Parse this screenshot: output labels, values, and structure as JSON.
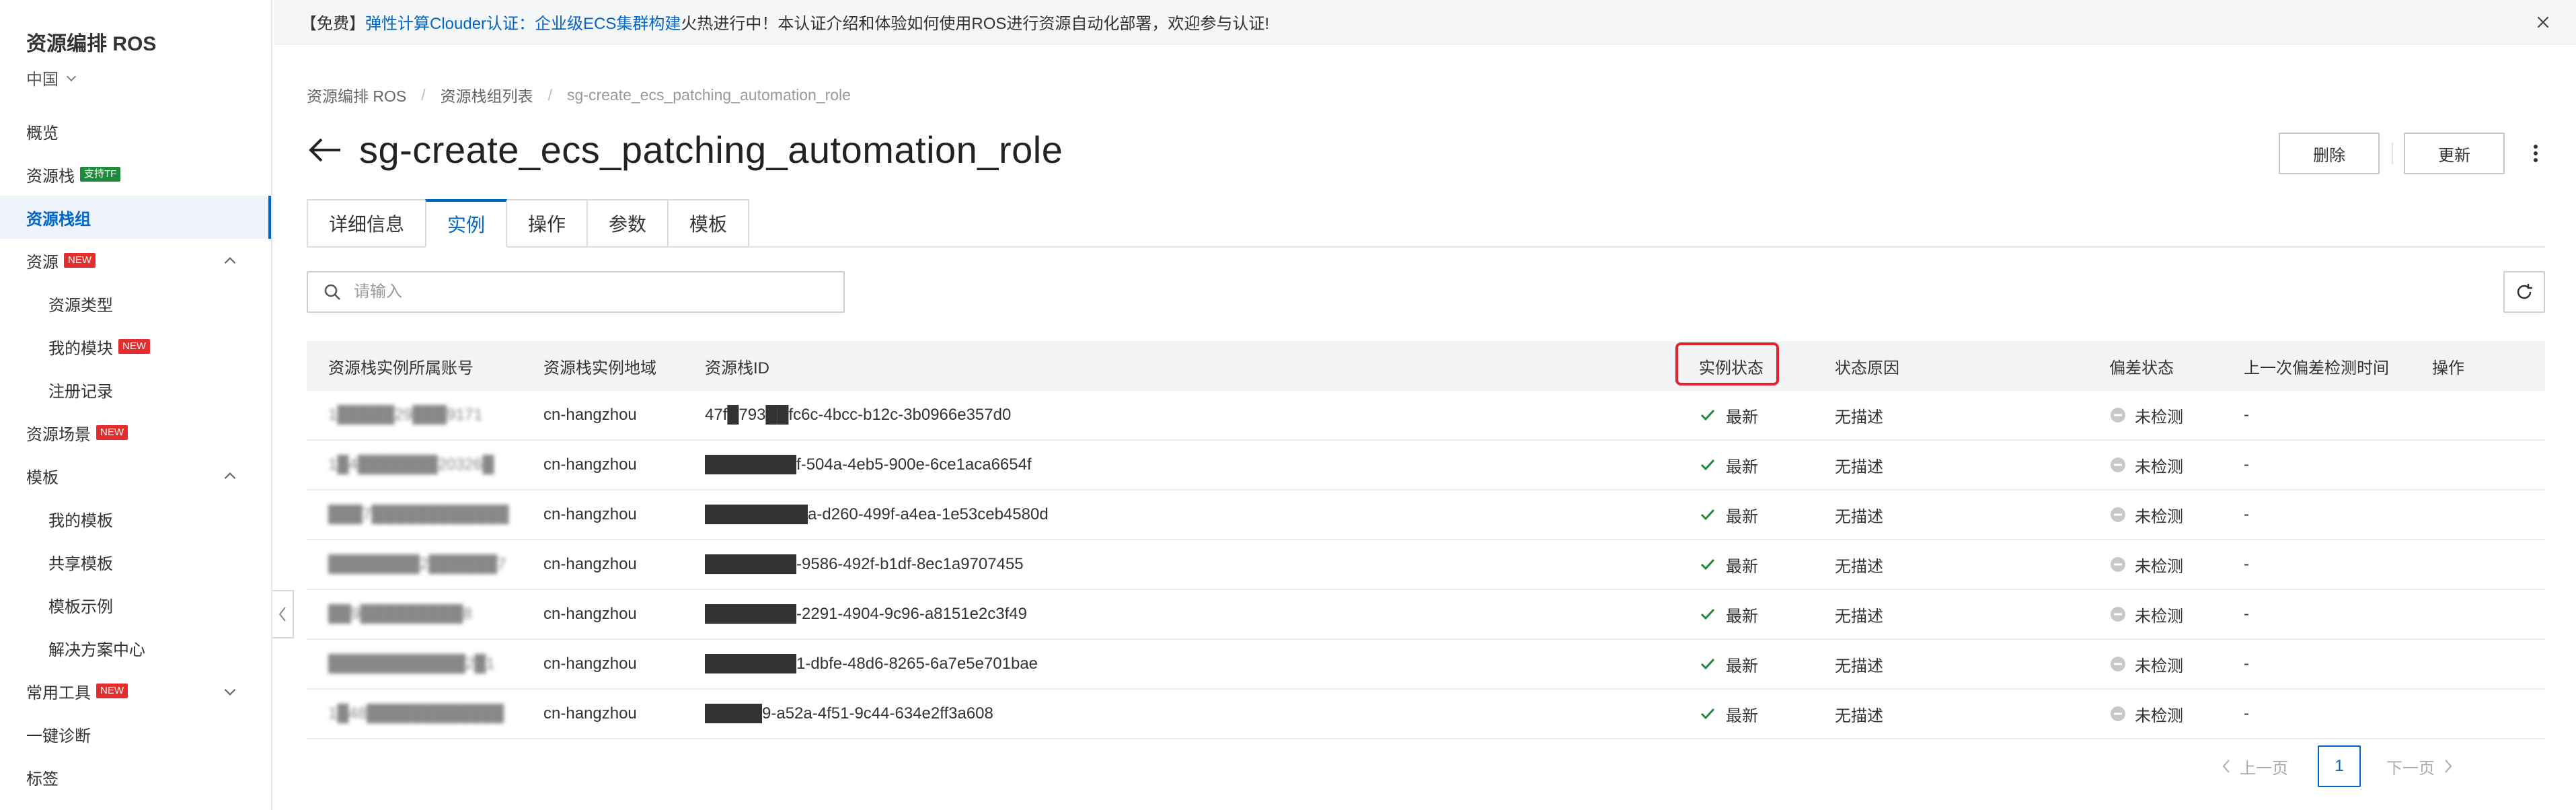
{
  "sidebar": {
    "title": "资源编排 ROS",
    "region": "中国",
    "items": [
      {
        "label": "概览"
      },
      {
        "label": "资源栈",
        "tag": "支持TF"
      },
      {
        "label": "资源栈组"
      },
      {
        "label": "资源",
        "tag": "NEW"
      },
      {
        "label": "资源类型"
      },
      {
        "label": "我的模块",
        "tag": "NEW"
      },
      {
        "label": "注册记录"
      },
      {
        "label": "资源场景",
        "tag": "NEW"
      },
      {
        "label": "模板"
      },
      {
        "label": "我的模板"
      },
      {
        "label": "共享模板"
      },
      {
        "label": "模板示例"
      },
      {
        "label": "解决方案中心"
      },
      {
        "label": "常用工具",
        "tag": "NEW"
      },
      {
        "label": "一键诊断"
      },
      {
        "label": "标签"
      }
    ]
  },
  "banner": {
    "prefix": "【免费】",
    "link": "弹性计算Clouder认证：企业级ECS集群构建",
    "text": "火热进行中！本认证介绍和体验如何使用ROS进行资源自动化部署，欢迎参与认证!"
  },
  "breadcrumb": [
    "资源编排 ROS",
    "资源栈组列表",
    "sg-create_ecs_patching_automation_role"
  ],
  "page_title": "sg-create_ecs_patching_automation_role",
  "buttons": {
    "delete": "删除",
    "update": "更新"
  },
  "tabs": [
    "详细信息",
    "实例",
    "操作",
    "参数",
    "模板"
  ],
  "search": {
    "placeholder": "请输入"
  },
  "table": {
    "columns": [
      "资源栈实例所属账号",
      "资源栈实例地域",
      "资源栈ID",
      "实例状态",
      "状态原因",
      "偏差状态",
      "上一次偏差检测时间",
      "操作"
    ],
    "rows": [
      {
        "account": "1█████29███9171",
        "region": "cn-hangzhou",
        "stack_id": "47f█793██fc6c-4bcc-b12c-3b0966e357d0",
        "status": "最新",
        "reason": "无描述",
        "drift": "未检测",
        "last_drift": "-"
      },
      {
        "account": "1█4███████20326█",
        "region": "cn-hangzhou",
        "stack_id": "████████f-504a-4eb5-900e-6ce1aca6654f",
        "status": "最新",
        "reason": "无描述",
        "drift": "未检测",
        "last_drift": "-"
      },
      {
        "account": "███7████████████",
        "region": "cn-hangzhou",
        "stack_id": "█████████a-d260-499f-a4ea-1e53ceb4580d",
        "status": "最新",
        "reason": "无描述",
        "drift": "未检测",
        "last_drift": "-"
      },
      {
        "account": "████████2██████7",
        "region": "cn-hangzhou",
        "stack_id": "████████-9586-492f-b1df-8ec1a9707455",
        "status": "最新",
        "reason": "无描述",
        "drift": "未检测",
        "last_drift": "-"
      },
      {
        "account": "██9█████████8",
        "region": "cn-hangzhou",
        "stack_id": "████████-2291-4904-9c96-a8151e2c3f49",
        "status": "最新",
        "reason": "无描述",
        "drift": "未检测",
        "last_drift": "-"
      },
      {
        "account": "████████████2█1",
        "region": "cn-hangzhou",
        "stack_id": "████████1-dbfe-48d6-8265-6a7e5e701bae",
        "status": "最新",
        "reason": "无描述",
        "drift": "未检测",
        "last_drift": "-"
      },
      {
        "account": "1█48████████████",
        "region": "cn-hangzhou",
        "stack_id": "█████9-a52a-4f51-9c44-634e2ff3a608",
        "status": "最新",
        "reason": "无描述",
        "drift": "未检测",
        "last_drift": "-"
      }
    ]
  },
  "pagination": {
    "prev": "上一页",
    "current": "1",
    "next": "下一页"
  },
  "colors": {
    "accent": "#0064c8",
    "success": "#1f8a3b",
    "new_tag": "#e62c2c",
    "highlight": "#e0232e"
  }
}
